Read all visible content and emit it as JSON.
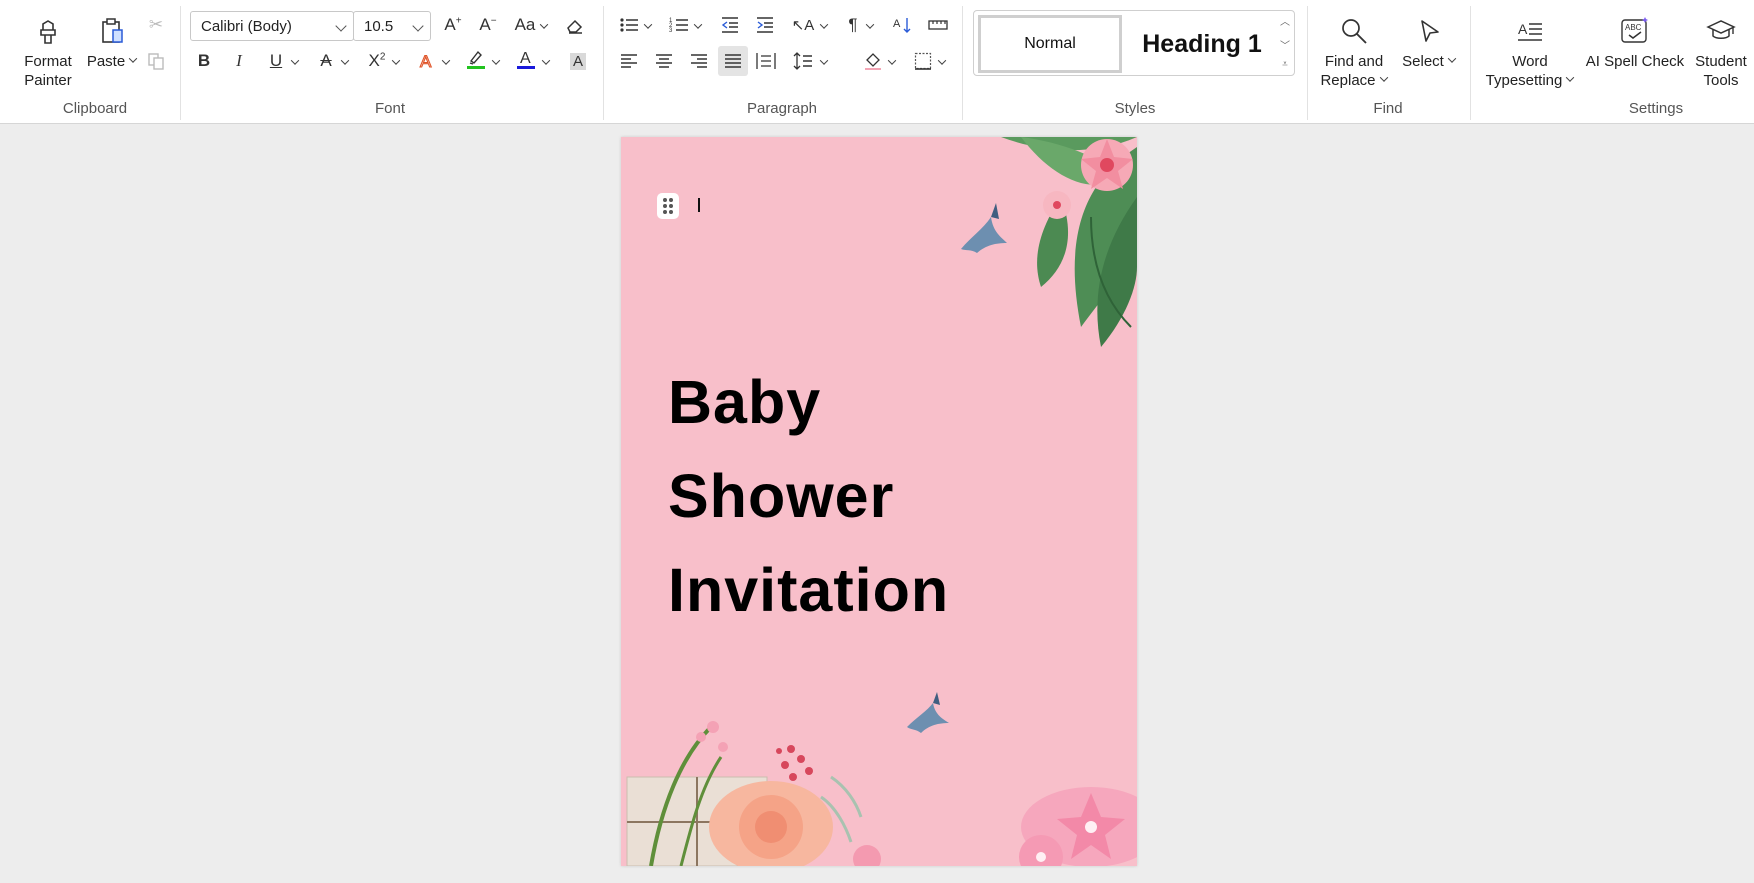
{
  "ribbon": {
    "clipboard": {
      "label": "Clipboard",
      "format_painter": [
        "Format",
        "Painter"
      ],
      "paste": "Paste"
    },
    "font": {
      "label": "Font",
      "font_name": "Calibri (Body)",
      "font_size": "10.5"
    },
    "paragraph": {
      "label": "Paragraph"
    },
    "styles": {
      "label": "Styles",
      "normal": "Normal",
      "heading1": "Heading 1"
    },
    "find": {
      "label": "Find",
      "find_replace": [
        "Find and",
        "Replace"
      ],
      "select": "Select"
    },
    "settings": {
      "label": "Settings",
      "word_typesetting": [
        "Word",
        "Typesetting"
      ],
      "ai_spell_check": "AI Spell Check",
      "student_tools": [
        "Student",
        "Tools"
      ]
    }
  },
  "colors": {
    "highlight": "#22c31f",
    "font_color": "#1a1adb",
    "page_background": "#f8bfca"
  },
  "document": {
    "title_lines": [
      "Baby",
      "Shower",
      "Invitation"
    ]
  }
}
